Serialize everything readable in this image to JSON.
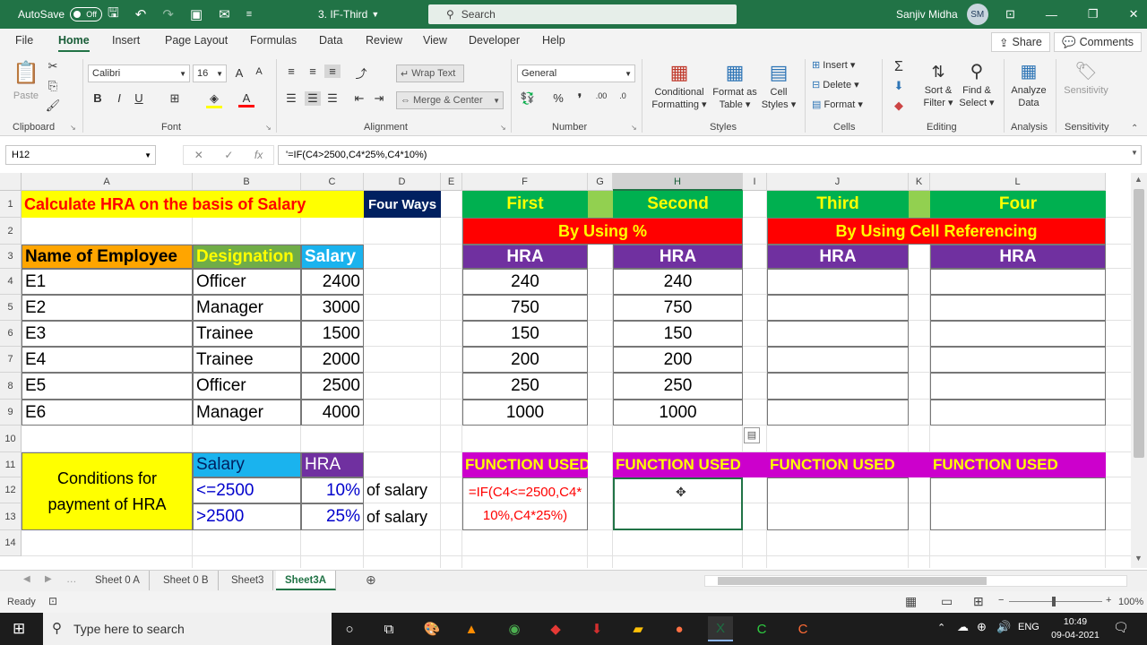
{
  "titlebar": {
    "autosave": "AutoSave",
    "autosave_state": "Off",
    "filename": "3. IF-Third",
    "search": "Search",
    "user": "Sanjiv Midha",
    "initials": "SM"
  },
  "menu": {
    "tabs": [
      "File",
      "Home",
      "Insert",
      "Page Layout",
      "Formulas",
      "Data",
      "Review",
      "View",
      "Developer",
      "Help"
    ],
    "share": "Share",
    "comments": "Comments"
  },
  "ribbon": {
    "clipboard": {
      "paste": "Paste",
      "label": "Clipboard"
    },
    "font": {
      "name": "Calibri",
      "size": "16",
      "label": "Font"
    },
    "alignment": {
      "wrap": "Wrap Text",
      "merge": "Merge & Center",
      "label": "Alignment"
    },
    "number": {
      "format": "General",
      "label": "Number"
    },
    "styles": {
      "conditional": "Conditional",
      "conditional2": "Formatting",
      "format_as": "Format as",
      "format_as2": "Table",
      "cell": "Cell",
      "cell2": "Styles",
      "label": "Styles"
    },
    "cells": {
      "insert": "Insert",
      "delete": "Delete",
      "format": "Format",
      "label": "Cells"
    },
    "editing": {
      "sort": "Sort &",
      "sort2": "Filter",
      "find": "Find &",
      "find2": "Select",
      "label": "Editing"
    },
    "analysis": {
      "analyze": "Analyze",
      "analyze2": "Data",
      "label": "Analysis"
    },
    "sensitivity": {
      "btn": "Sensitivity",
      "label": "Sensitivity"
    }
  },
  "formula_bar": {
    "cell": "H12",
    "formula": "'=IF(C4>2500,C4*25%,C4*10%)",
    "fx": "fx"
  },
  "columns": [
    "A",
    "B",
    "C",
    "D",
    "E",
    "F",
    "G",
    "H",
    "I",
    "J",
    "K",
    "L"
  ],
  "rows": [
    "1",
    "2",
    "3",
    "4",
    "5",
    "6",
    "7",
    "8",
    "9",
    "10",
    "11",
    "12",
    "13",
    "14"
  ],
  "sheet": {
    "title": "Calculate HRA on the basis of Salary",
    "four_ways": "Four Ways",
    "first": "First",
    "second": "Second",
    "third": "Third",
    "four": "Four",
    "by_percent": "By Using %",
    "by_ref": "By Using Cell Referencing",
    "hra": "HRA",
    "headers": {
      "name": "Name of Employee",
      "designation": "Designation",
      "salary": "Salary"
    },
    "employees": [
      {
        "name": "E1",
        "designation": "Officer",
        "salary": "2400",
        "hra_f": "240",
        "hra_h": "240"
      },
      {
        "name": "E2",
        "designation": "Manager",
        "salary": "3000",
        "hra_f": "750",
        "hra_h": "750"
      },
      {
        "name": "E3",
        "designation": "Trainee",
        "salary": "1500",
        "hra_f": "150",
        "hra_h": "150"
      },
      {
        "name": "E4",
        "designation": "Trainee",
        "salary": "2000",
        "hra_f": "200",
        "hra_h": "200"
      },
      {
        "name": "E5",
        "designation": "Officer",
        "salary": "2500",
        "hra_f": "250",
        "hra_h": "250"
      },
      {
        "name": "E6",
        "designation": "Manager",
        "salary": "4000",
        "hra_f": "1000",
        "hra_h": "1000"
      }
    ],
    "conditions_label": "Conditions for payment of HRA",
    "cond_salary": "Salary",
    "cond_hra": "HRA",
    "cond1": {
      "range": "<=2500",
      "pct": "10%",
      "suffix": "of salary"
    },
    "cond2": {
      "range": ">2500",
      "pct": "25%",
      "suffix": "of salary"
    },
    "function_used": "FUNCTION USED",
    "function_formula": "=IF(C4<=2500,C4*10%,C4*25%)"
  },
  "sheet_tabs": [
    "Sheet 0 A",
    "Sheet 0 B",
    "Sheet3",
    "Sheet3A"
  ],
  "status": {
    "ready": "Ready",
    "zoom": "100%"
  },
  "taskbar": {
    "search": "Type here to search",
    "time": "10:49",
    "date": "09-04-2021",
    "lang": "ENG"
  },
  "colors": {
    "green": "#217346",
    "yellow": "#ffff00",
    "orange": "#ffa500",
    "lime": "#5cb85c",
    "cyan": "#1ab3ee",
    "purple": "#7030a0",
    "red": "#ff0000",
    "magenta": "#cc00cc",
    "navy": "#002060"
  }
}
